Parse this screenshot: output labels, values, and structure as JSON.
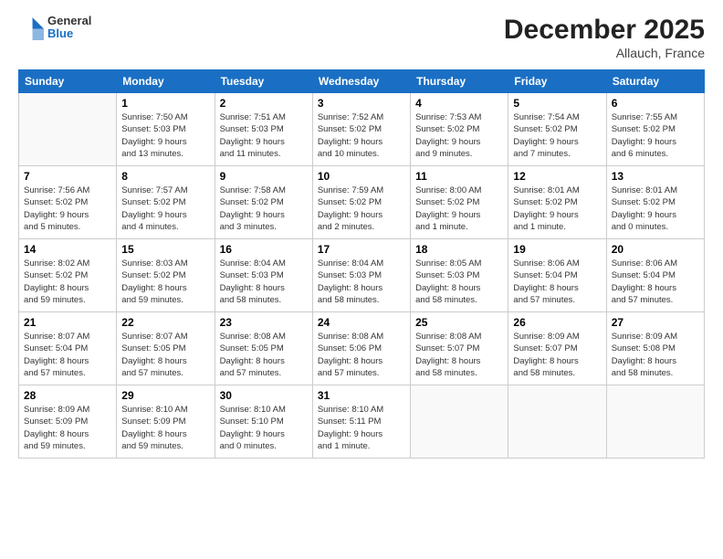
{
  "header": {
    "logo": {
      "general": "General",
      "blue": "Blue"
    },
    "title": "December 2025",
    "location": "Allauch, France"
  },
  "days_of_week": [
    "Sunday",
    "Monday",
    "Tuesday",
    "Wednesday",
    "Thursday",
    "Friday",
    "Saturday"
  ],
  "weeks": [
    [
      {
        "day": "",
        "info": ""
      },
      {
        "day": "1",
        "info": "Sunrise: 7:50 AM\nSunset: 5:03 PM\nDaylight: 9 hours\nand 13 minutes."
      },
      {
        "day": "2",
        "info": "Sunrise: 7:51 AM\nSunset: 5:03 PM\nDaylight: 9 hours\nand 11 minutes."
      },
      {
        "day": "3",
        "info": "Sunrise: 7:52 AM\nSunset: 5:02 PM\nDaylight: 9 hours\nand 10 minutes."
      },
      {
        "day": "4",
        "info": "Sunrise: 7:53 AM\nSunset: 5:02 PM\nDaylight: 9 hours\nand 9 minutes."
      },
      {
        "day": "5",
        "info": "Sunrise: 7:54 AM\nSunset: 5:02 PM\nDaylight: 9 hours\nand 7 minutes."
      },
      {
        "day": "6",
        "info": "Sunrise: 7:55 AM\nSunset: 5:02 PM\nDaylight: 9 hours\nand 6 minutes."
      }
    ],
    [
      {
        "day": "7",
        "info": "Sunrise: 7:56 AM\nSunset: 5:02 PM\nDaylight: 9 hours\nand 5 minutes."
      },
      {
        "day": "8",
        "info": "Sunrise: 7:57 AM\nSunset: 5:02 PM\nDaylight: 9 hours\nand 4 minutes."
      },
      {
        "day": "9",
        "info": "Sunrise: 7:58 AM\nSunset: 5:02 PM\nDaylight: 9 hours\nand 3 minutes."
      },
      {
        "day": "10",
        "info": "Sunrise: 7:59 AM\nSunset: 5:02 PM\nDaylight: 9 hours\nand 2 minutes."
      },
      {
        "day": "11",
        "info": "Sunrise: 8:00 AM\nSunset: 5:02 PM\nDaylight: 9 hours\nand 1 minute."
      },
      {
        "day": "12",
        "info": "Sunrise: 8:01 AM\nSunset: 5:02 PM\nDaylight: 9 hours\nand 1 minute."
      },
      {
        "day": "13",
        "info": "Sunrise: 8:01 AM\nSunset: 5:02 PM\nDaylight: 9 hours\nand 0 minutes."
      }
    ],
    [
      {
        "day": "14",
        "info": "Sunrise: 8:02 AM\nSunset: 5:02 PM\nDaylight: 8 hours\nand 59 minutes."
      },
      {
        "day": "15",
        "info": "Sunrise: 8:03 AM\nSunset: 5:02 PM\nDaylight: 8 hours\nand 59 minutes."
      },
      {
        "day": "16",
        "info": "Sunrise: 8:04 AM\nSunset: 5:03 PM\nDaylight: 8 hours\nand 58 minutes."
      },
      {
        "day": "17",
        "info": "Sunrise: 8:04 AM\nSunset: 5:03 PM\nDaylight: 8 hours\nand 58 minutes."
      },
      {
        "day": "18",
        "info": "Sunrise: 8:05 AM\nSunset: 5:03 PM\nDaylight: 8 hours\nand 58 minutes."
      },
      {
        "day": "19",
        "info": "Sunrise: 8:06 AM\nSunset: 5:04 PM\nDaylight: 8 hours\nand 57 minutes."
      },
      {
        "day": "20",
        "info": "Sunrise: 8:06 AM\nSunset: 5:04 PM\nDaylight: 8 hours\nand 57 minutes."
      }
    ],
    [
      {
        "day": "21",
        "info": "Sunrise: 8:07 AM\nSunset: 5:04 PM\nDaylight: 8 hours\nand 57 minutes."
      },
      {
        "day": "22",
        "info": "Sunrise: 8:07 AM\nSunset: 5:05 PM\nDaylight: 8 hours\nand 57 minutes."
      },
      {
        "day": "23",
        "info": "Sunrise: 8:08 AM\nSunset: 5:05 PM\nDaylight: 8 hours\nand 57 minutes."
      },
      {
        "day": "24",
        "info": "Sunrise: 8:08 AM\nSunset: 5:06 PM\nDaylight: 8 hours\nand 57 minutes."
      },
      {
        "day": "25",
        "info": "Sunrise: 8:08 AM\nSunset: 5:07 PM\nDaylight: 8 hours\nand 58 minutes."
      },
      {
        "day": "26",
        "info": "Sunrise: 8:09 AM\nSunset: 5:07 PM\nDaylight: 8 hours\nand 58 minutes."
      },
      {
        "day": "27",
        "info": "Sunrise: 8:09 AM\nSunset: 5:08 PM\nDaylight: 8 hours\nand 58 minutes."
      }
    ],
    [
      {
        "day": "28",
        "info": "Sunrise: 8:09 AM\nSunset: 5:09 PM\nDaylight: 8 hours\nand 59 minutes."
      },
      {
        "day": "29",
        "info": "Sunrise: 8:10 AM\nSunset: 5:09 PM\nDaylight: 8 hours\nand 59 minutes."
      },
      {
        "day": "30",
        "info": "Sunrise: 8:10 AM\nSunset: 5:10 PM\nDaylight: 9 hours\nand 0 minutes."
      },
      {
        "day": "31",
        "info": "Sunrise: 8:10 AM\nSunset: 5:11 PM\nDaylight: 9 hours\nand 1 minute."
      },
      {
        "day": "",
        "info": ""
      },
      {
        "day": "",
        "info": ""
      },
      {
        "day": "",
        "info": ""
      }
    ]
  ]
}
